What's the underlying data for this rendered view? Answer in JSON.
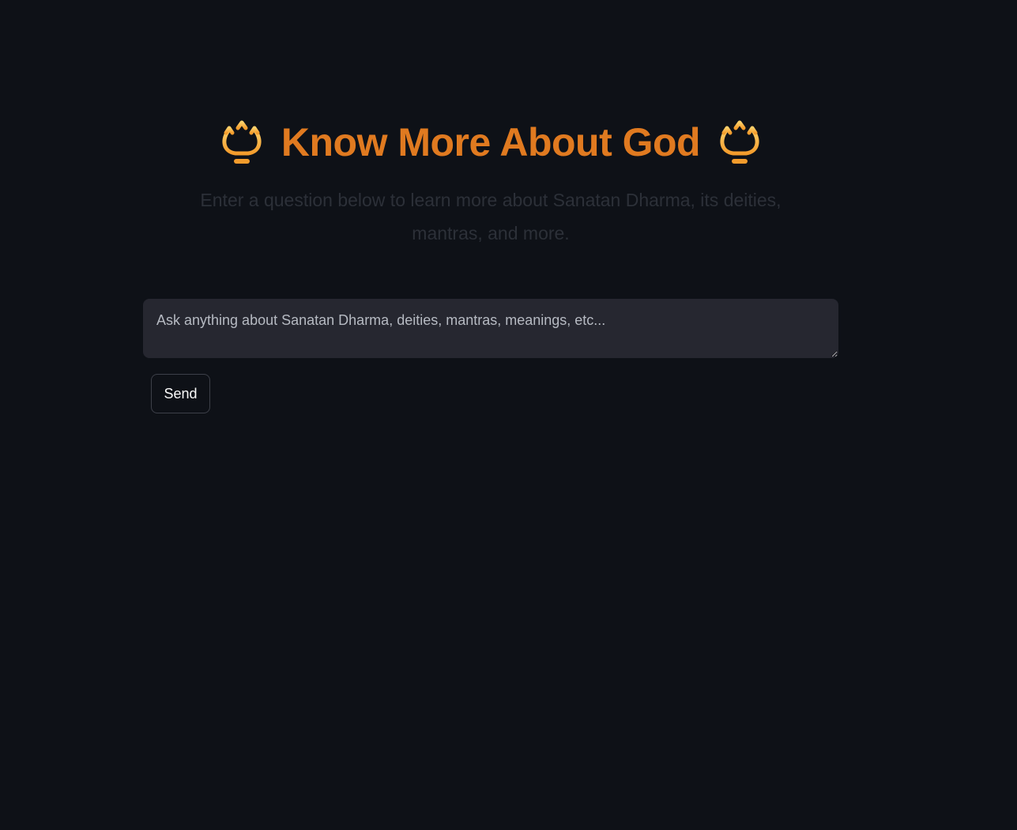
{
  "header": {
    "title": "Know More About God",
    "left_icon": "trident-icon",
    "right_icon": "trident-icon",
    "subtitle": "Enter a question below to learn more about Sanatan Dharma, its deities, mantras, and more."
  },
  "question": {
    "value": "",
    "placeholder": "Ask anything about Sanatan Dharma, deities, mantras, meanings, etc..."
  },
  "send_label": "Send",
  "colors": {
    "background": "#0e1117",
    "title": "#e07a20",
    "icon": "#f5b041",
    "input_background": "#262730"
  }
}
